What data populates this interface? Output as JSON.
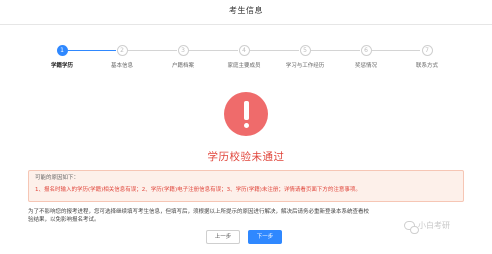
{
  "header": {
    "title": "考生信息"
  },
  "steps": [
    {
      "num": "1",
      "label": "学籍学历"
    },
    {
      "num": "2",
      "label": "基本信息"
    },
    {
      "num": "3",
      "label": "户籍档案"
    },
    {
      "num": "4",
      "label": "家庭主要成员"
    },
    {
      "num": "5",
      "label": "学习与工作经历"
    },
    {
      "num": "6",
      "label": "奖惩情况"
    },
    {
      "num": "7",
      "label": "联系方式"
    }
  ],
  "result": {
    "title": "学历校验未通过"
  },
  "reasons": {
    "heading": "可能的原因如下：",
    "text": "1、报名时输入的学历(学籍)相关信息有误；2、学历(学籍)电子注册信息有误；3、学历(学籍)未注册；详情请看页面下方的注意事项。"
  },
  "note": "为了不影响您的报考进程，您可选择继续填写考生信息，但填写后，须根据以上所提示的原因进行解决，解决后请务必重新登录本系统查看校验结果，以免影响报名考试。",
  "buttons": {
    "prev": "上一步",
    "next": "下一步"
  },
  "watermark": {
    "text": "小白考研",
    "icon": "wechat-icon"
  },
  "colors": {
    "accent": "#2f88ff",
    "error": "#e0453b",
    "error_icon": "#ef6b6b",
    "alert_bg": "#fdf0ea"
  }
}
